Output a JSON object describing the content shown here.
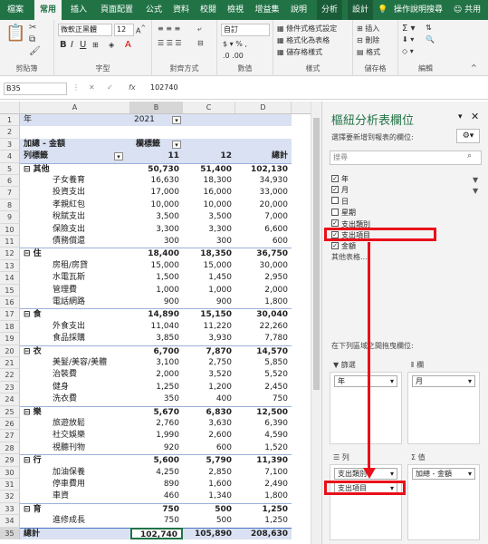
{
  "menubar": {
    "tabs": [
      "檔案",
      "常用",
      "插入",
      "頁面配置",
      "公式",
      "資料",
      "校閱",
      "檢視",
      "增益集",
      "說明",
      "分析",
      "設計"
    ],
    "active_tab": "常用",
    "tell_me": "操作說明搜尋",
    "share": "共用"
  },
  "ribbon": {
    "clipboard_label": "剪貼簿",
    "font_name": "微軟正黑體",
    "font_size": "12",
    "font_label": "字型",
    "align_label": "對齊方式",
    "number_format": "自訂",
    "number_label": "數值",
    "cond_format": "條件式格式設定",
    "table_format": "格式化為表格",
    "cell_style": "儲存格樣式",
    "style_label": "樣式",
    "insert": "插入",
    "delete": "刪除",
    "format": "格式",
    "cells_label": "儲存格",
    "edit_label": "編輯"
  },
  "formula": {
    "namebox": "B35",
    "fx": "fx",
    "value": "102740"
  },
  "grid": {
    "col_headers": [
      "A",
      "B",
      "C",
      "D"
    ],
    "row_headers": [
      "1",
      "2",
      "3",
      "4",
      "5",
      "6",
      "7",
      "8",
      "9",
      "10",
      "11",
      "12",
      "13",
      "14",
      "15",
      "16",
      "17",
      "18",
      "19",
      "20",
      "21",
      "22",
      "23",
      "24",
      "25",
      "26",
      "27",
      "28",
      "29",
      "30",
      "31",
      "32",
      "33",
      "34",
      "35"
    ],
    "rows": [
      [
        "年",
        "2021",
        "",
        ""
      ],
      [
        "",
        "",
        "",
        ""
      ],
      [
        "加總 - 金額",
        "欄標籤",
        "",
        ""
      ],
      [
        "列標籤",
        "11",
        "12",
        "總計"
      ],
      [
        "⊟ 其他",
        "50,730",
        "51,400",
        "102,130"
      ],
      [
        "子女養育",
        "16,630",
        "18,300",
        "34,930"
      ],
      [
        "投資支出",
        "17,000",
        "16,000",
        "33,000"
      ],
      [
        "孝親紅包",
        "10,000",
        "10,000",
        "20,000"
      ],
      [
        "稅賦支出",
        "3,500",
        "3,500",
        "7,000"
      ],
      [
        "保險支出",
        "3,300",
        "3,300",
        "6,600"
      ],
      [
        "債務償還",
        "300",
        "300",
        "600"
      ],
      [
        "⊟ 住",
        "18,400",
        "18,350",
        "36,750"
      ],
      [
        "房租/房貸",
        "15,000",
        "15,000",
        "30,000"
      ],
      [
        "水電瓦斯",
        "1,500",
        "1,450",
        "2,950"
      ],
      [
        "管理費",
        "1,000",
        "1,000",
        "2,000"
      ],
      [
        "電話網路",
        "900",
        "900",
        "1,800"
      ],
      [
        "⊟ 食",
        "14,890",
        "15,150",
        "30,040"
      ],
      [
        "外食支出",
        "11,040",
        "11,220",
        "22,260"
      ],
      [
        "食品採購",
        "3,850",
        "3,930",
        "7,780"
      ],
      [
        "⊟ 衣",
        "6,700",
        "7,870",
        "14,570"
      ],
      [
        "美髮/美容/美體",
        "3,100",
        "2,750",
        "5,850"
      ],
      [
        "治裝費",
        "2,000",
        "3,520",
        "5,520"
      ],
      [
        "健身",
        "1,250",
        "1,200",
        "2,450"
      ],
      [
        "洗衣費",
        "350",
        "400",
        "750"
      ],
      [
        "⊟ 樂",
        "5,670",
        "6,830",
        "12,500"
      ],
      [
        "旅遊放鬆",
        "2,760",
        "3,630",
        "6,390"
      ],
      [
        "社交娛樂",
        "1,990",
        "2,600",
        "4,590"
      ],
      [
        "視聽刊物",
        "920",
        "600",
        "1,520"
      ],
      [
        "⊟ 行",
        "5,600",
        "5,790",
        "11,390"
      ],
      [
        "加油保養",
        "4,250",
        "2,850",
        "7,100"
      ],
      [
        "停車費用",
        "890",
        "1,600",
        "2,490"
      ],
      [
        "車資",
        "460",
        "1,340",
        "1,800"
      ],
      [
        "⊟ 育",
        "750",
        "500",
        "1,250"
      ],
      [
        "進修成長",
        "750",
        "500",
        "1,250"
      ],
      [
        "總計",
        "102,740",
        "105,890",
        "208,630"
      ]
    ]
  },
  "panel": {
    "title": "樞紐分析表欄位",
    "subtitle": "選擇要新增到報表的欄位:",
    "search_placeholder": "搜尋",
    "fields": [
      {
        "label": "年",
        "checked": true
      },
      {
        "label": "月",
        "checked": true
      },
      {
        "label": "日",
        "checked": false
      },
      {
        "label": "星期",
        "checked": false
      },
      {
        "label": "支出類別",
        "checked": true
      },
      {
        "label": "支出項目",
        "checked": true
      },
      {
        "label": "金額",
        "checked": true
      }
    ],
    "more_tables": "其他表格...",
    "drag_hint": "在下列區域之間拖曳欄位:",
    "filter_title": "篩選",
    "columns_title": "欄",
    "rows_title": "列",
    "values_title": "值",
    "filter_chip": "年",
    "columns_chip": "月",
    "rows_chips": [
      "支出類別",
      "支出項目"
    ],
    "values_chip": "加總 - 金額"
  },
  "colors": {
    "excel_green": "#217346",
    "highlight_red": "#e8101a",
    "pivot_header_fill": "#d9e1f2"
  }
}
